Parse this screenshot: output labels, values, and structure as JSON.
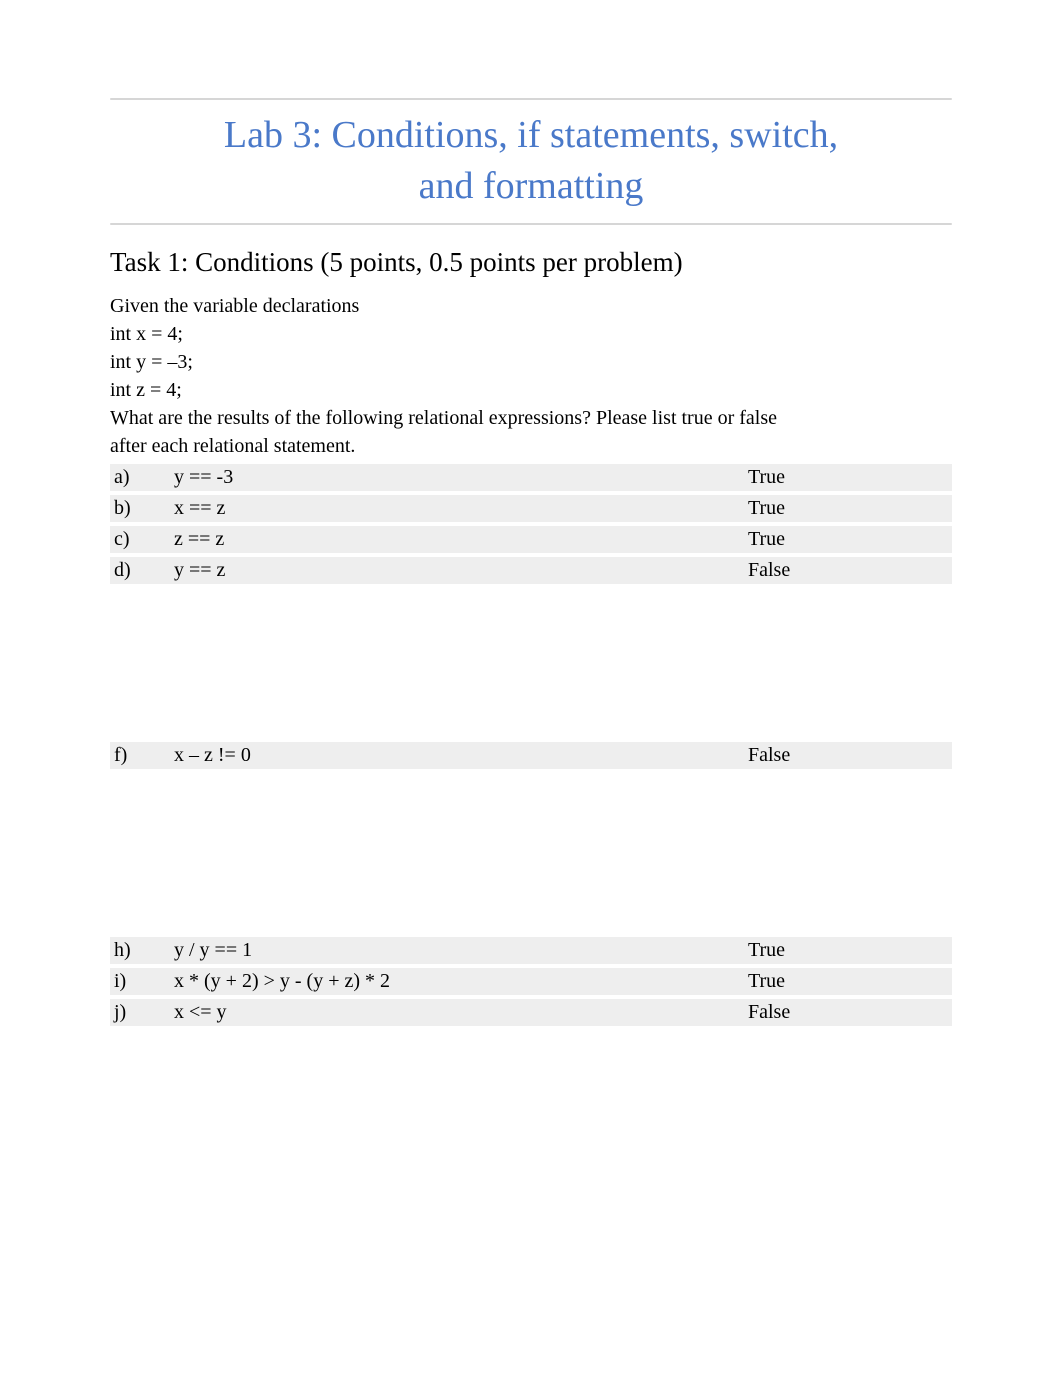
{
  "title": {
    "line1": "Lab 3: Conditions, if statements, switch,",
    "line2": "and formatting"
  },
  "task": {
    "heading": "Task 1: Conditions (5 points, 0.5 points per problem)",
    "intro_lines": [
      "Given the variable declarations",
      "int x = 4;",
      "int y = –3;",
      "int z = 4;",
      "What are the results of the following relational expressions? Please list true or false",
      "after each relational statement."
    ]
  },
  "rows_block1": [
    {
      "label": "a)",
      "expr": "y == -3",
      "ans": "True"
    },
    {
      "label": "b)",
      "expr": "x == z",
      "ans": "True"
    },
    {
      "label": "c)",
      "expr": "z == z",
      "ans": "True"
    },
    {
      "label": "d)",
      "expr": "y == z",
      "ans": "False"
    }
  ],
  "rows_block2": [
    {
      "label": "f)",
      "expr": "x – z != 0",
      "ans": "False"
    }
  ],
  "rows_block3": [
    {
      "label": "h)",
      "expr": "y / y == 1",
      "ans": "True"
    },
    {
      "label": "i)",
      "expr": "x * (y + 2) > y - (y + z) * 2",
      "ans": "True"
    },
    {
      "label": "j)",
      "expr": "x <= y",
      "ans": "False"
    }
  ]
}
